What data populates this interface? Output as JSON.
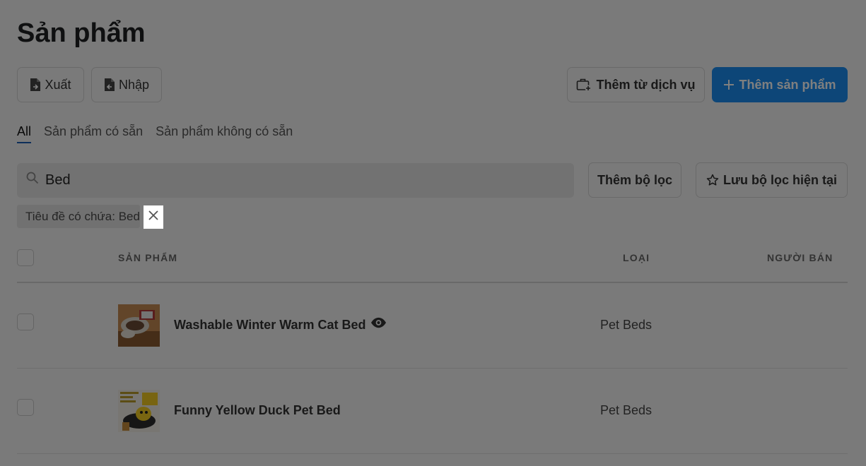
{
  "page": {
    "title": "Sản phẩm"
  },
  "toolbar": {
    "export_label": "Xuất",
    "import_label": "Nhập",
    "add_from_service_label": "Thêm từ dịch vụ",
    "add_product_label": "Thêm sản phẩm"
  },
  "tabs": [
    {
      "label": "All",
      "active": true
    },
    {
      "label": "Sản phẩm có sẵn",
      "active": false
    },
    {
      "label": "Sản phẩm không có sẵn",
      "active": false
    }
  ],
  "search": {
    "value": "Bed"
  },
  "filters": {
    "add_filter_label": "Thêm bộ lọc",
    "save_filter_label": "Lưu bộ lọc hiện tại",
    "active_chip": "Tiêu đề có chứa: Bed"
  },
  "table": {
    "headers": {
      "product": "SẢN PHẨM",
      "type": "LOẠI",
      "vendor": "NGƯỜI BÁN"
    },
    "rows": [
      {
        "name": "Washable Winter Warm Cat Bed",
        "type": "Pet Beds",
        "vendor": "",
        "visible_icon": "eye-icon"
      },
      {
        "name": "Funny Yellow Duck Pet Bed",
        "type": "Pet Beds",
        "vendor": ""
      }
    ]
  },
  "colors": {
    "primary": "#1a8df0",
    "overlay": "rgba(0,0,0,0.5)"
  }
}
